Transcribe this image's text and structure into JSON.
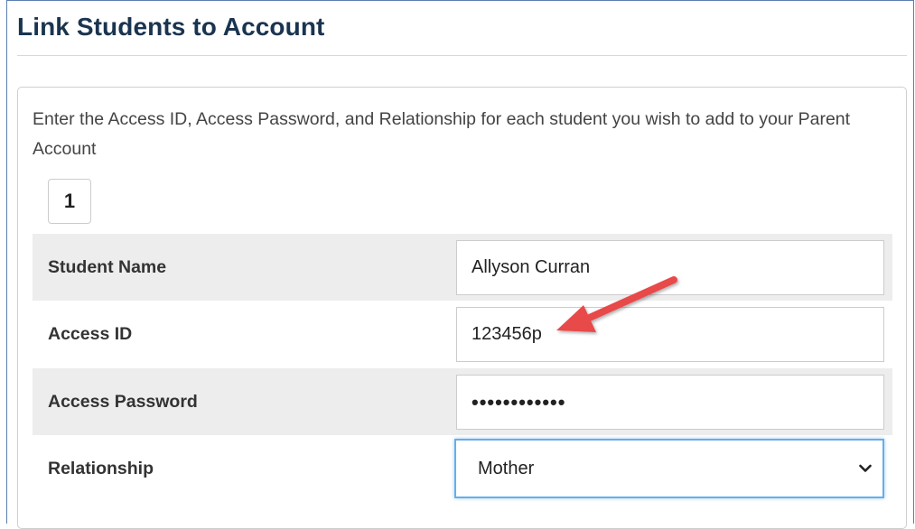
{
  "page": {
    "title": "Link Students to Account",
    "instructions": "Enter the Access ID, Access Password, and Relationship for each student you wish to add to your Parent Account"
  },
  "step": {
    "number": "1"
  },
  "form": {
    "student_name": {
      "label": "Student Name",
      "value": "Allyson Curran"
    },
    "access_id": {
      "label": "Access ID",
      "value": "123456p"
    },
    "access_password": {
      "label": "Access Password",
      "value": "••••••••••••"
    },
    "relationship": {
      "label": "Relationship",
      "selected": "Mother"
    }
  },
  "icons": {
    "chevron": "chevron-down-icon",
    "annotation": "red-arrow-annotation"
  },
  "colors": {
    "title": "#1a3450",
    "arrow": "#e84a4a",
    "focus_border": "#66afe9",
    "row_shade": "#ededed"
  }
}
